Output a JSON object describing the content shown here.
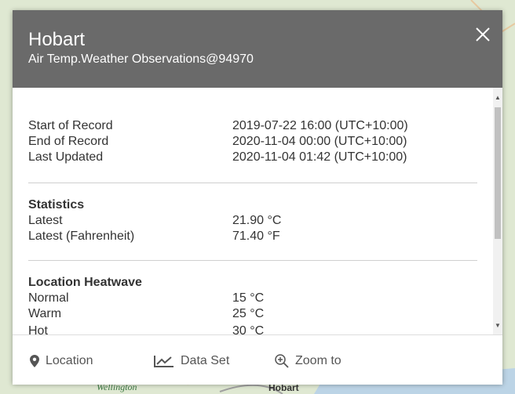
{
  "map": {
    "labels": {
      "wellington": "Wellington",
      "hobart": "Hobart"
    }
  },
  "popup": {
    "title": "Hobart",
    "subtitle": "Air Temp.Weather Observations@94970",
    "record": {
      "start_label": "Start of Record",
      "start_value": "2019-07-22 16:00 (UTC+10:00)",
      "end_label": "End of Record",
      "end_value": "2020-11-04 00:00 (UTC+10:00)",
      "updated_label": "Last Updated",
      "updated_value": "2020-11-04 01:42 (UTC+10:00)"
    },
    "statistics": {
      "heading": "Statistics",
      "latest_label": "Latest",
      "latest_value": "21.90 °C",
      "fahrenheit_label": "Latest (Fahrenheit)",
      "fahrenheit_value": "71.40 °F"
    },
    "heatwave": {
      "heading": "Location Heatwave",
      "normal_label": "Normal",
      "normal_value": "15 °C",
      "warm_label": "Warm",
      "warm_value": "25 °C",
      "hot_label": "Hot",
      "hot_value": "30 °C"
    },
    "actions": {
      "location": "Location",
      "dataset": "Data Set",
      "zoom": "Zoom to"
    }
  }
}
